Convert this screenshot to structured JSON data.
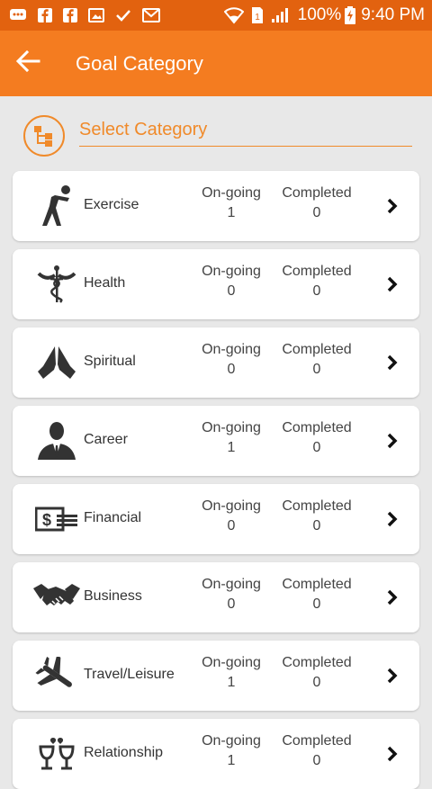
{
  "status_bar": {
    "battery": "100%",
    "time": "9:40 PM",
    "notification_icons": [
      "chat-icon",
      "facebook-icon",
      "facebook-icon",
      "image-icon",
      "checkmark-icon",
      "gmail-icon"
    ]
  },
  "app_bar": {
    "title": "Goal Category",
    "back_icon": "arrow-left-icon"
  },
  "select_category": {
    "label": "Select Category",
    "icon": "hierarchy-icon"
  },
  "stats_labels": {
    "ongoing": "On-going",
    "completed": "Completed"
  },
  "categories": [
    {
      "name": "Exercise",
      "icon": "exercise-icon",
      "ongoing": "1",
      "completed": "0"
    },
    {
      "name": "Health",
      "icon": "caduceus-icon",
      "ongoing": "0",
      "completed": "0"
    },
    {
      "name": "Spiritual",
      "icon": "praying-hands-icon",
      "ongoing": "0",
      "completed": "0"
    },
    {
      "name": "Career",
      "icon": "businessman-icon",
      "ongoing": "1",
      "completed": "0"
    },
    {
      "name": "Financial",
      "icon": "money-icon",
      "ongoing": "0",
      "completed": "0"
    },
    {
      "name": "Business",
      "icon": "handshake-icon",
      "ongoing": "0",
      "completed": "0"
    },
    {
      "name": "Travel/Leisure",
      "icon": "airplane-icon",
      "ongoing": "1",
      "completed": "0"
    },
    {
      "name": "Relationship",
      "icon": "wine-glasses-icon",
      "ongoing": "1",
      "completed": "0"
    }
  ],
  "colors": {
    "accent": "#f47c20",
    "status_bar": "#e2620f",
    "background": "#e8e8e8",
    "card": "#ffffff"
  }
}
